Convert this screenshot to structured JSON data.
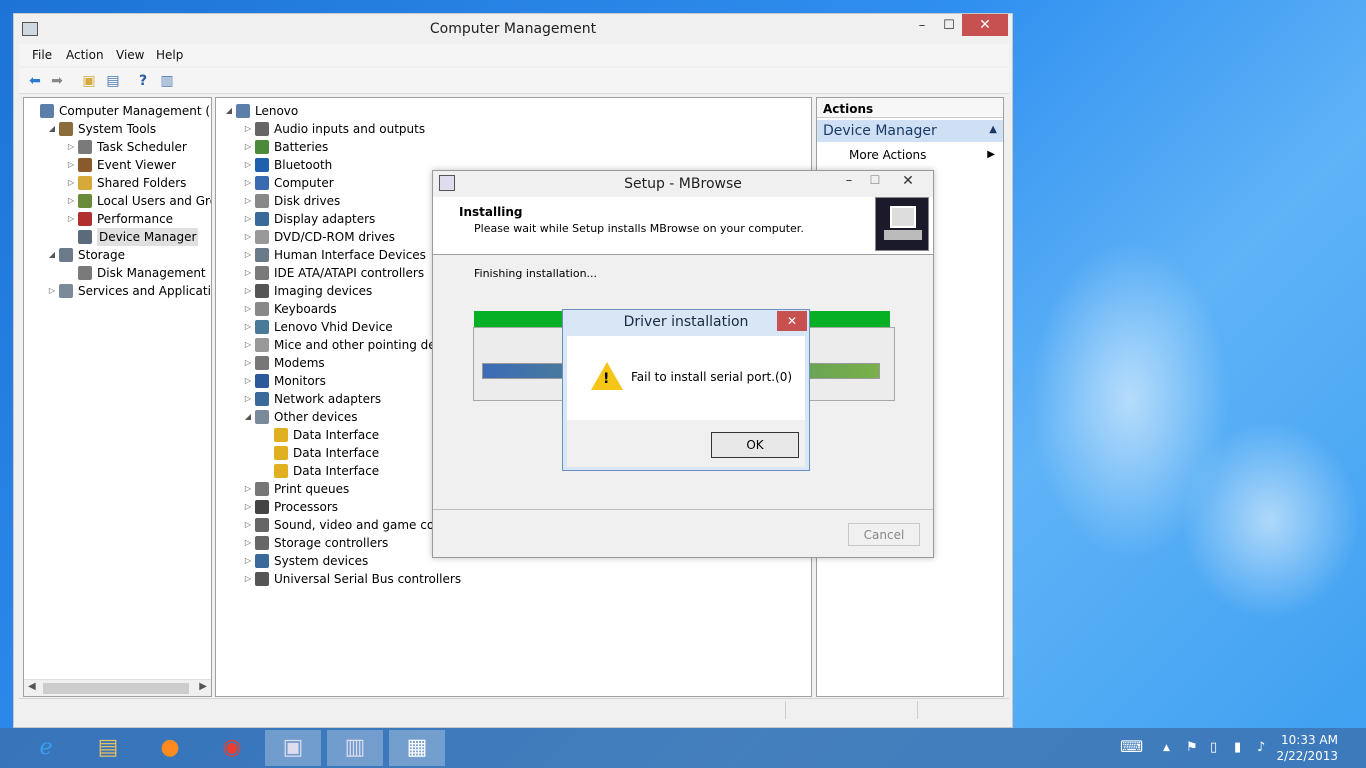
{
  "window": {
    "title": "Computer Management",
    "minimize": "–",
    "maximize": "☐",
    "close": "✕"
  },
  "menu": [
    "File",
    "Action",
    "View",
    "Help"
  ],
  "left_tree": [
    {
      "label": "Computer Management (Local",
      "level": 0,
      "exp": "",
      "icon": "computer-management-icon",
      "color": "#5b7fa8"
    },
    {
      "label": "System Tools",
      "level": 1,
      "exp": "◢",
      "icon": "system-tools-icon",
      "color": "#8a6d3b"
    },
    {
      "label": "Task Scheduler",
      "level": 2,
      "exp": "▷",
      "icon": "clock-icon",
      "color": "#7a7a7a"
    },
    {
      "label": "Event Viewer",
      "level": 2,
      "exp": "▷",
      "icon": "event-viewer-icon",
      "color": "#8a5a2a"
    },
    {
      "label": "Shared Folders",
      "level": 2,
      "exp": "▷",
      "icon": "shared-folder-icon",
      "color": "#d6a93a"
    },
    {
      "label": "Local Users and Groups",
      "level": 2,
      "exp": "▷",
      "icon": "users-icon",
      "color": "#6a8c3a"
    },
    {
      "label": "Performance",
      "level": 2,
      "exp": "▷",
      "icon": "performance-icon",
      "color": "#b03030"
    },
    {
      "label": "Device Manager",
      "level": 2,
      "exp": "",
      "icon": "device-manager-icon",
      "color": "#5b6b7b",
      "selected": true
    },
    {
      "label": "Storage",
      "level": 1,
      "exp": "◢",
      "icon": "storage-icon",
      "color": "#6b7b8b"
    },
    {
      "label": "Disk Management",
      "level": 2,
      "exp": "",
      "icon": "disk-icon",
      "color": "#7a7a7a"
    },
    {
      "label": "Services and Applications",
      "level": 1,
      "exp": "▷",
      "icon": "services-icon",
      "color": "#7a8a9a"
    }
  ],
  "device_tree": [
    {
      "label": "Lenovo",
      "level": 0,
      "exp": "◢",
      "icon": "computer-icon",
      "color": "#5b7fa8"
    },
    {
      "label": "Audio inputs and outputs",
      "level": 1,
      "exp": "▷",
      "icon": "speaker-icon",
      "color": "#666"
    },
    {
      "label": "Batteries",
      "level": 1,
      "exp": "▷",
      "icon": "battery-icon",
      "color": "#4a8a3a"
    },
    {
      "label": "Bluetooth",
      "level": 1,
      "exp": "▷",
      "icon": "bluetooth-icon",
      "color": "#1f5fb0"
    },
    {
      "label": "Computer",
      "level": 1,
      "exp": "▷",
      "icon": "computer-icon",
      "color": "#3a6ab0"
    },
    {
      "label": "Disk drives",
      "level": 1,
      "exp": "▷",
      "icon": "disk-icon",
      "color": "#888"
    },
    {
      "label": "Display adapters",
      "level": 1,
      "exp": "▷",
      "icon": "display-icon",
      "color": "#3a6a9a"
    },
    {
      "label": "DVD/CD-ROM drives",
      "level": 1,
      "exp": "▷",
      "icon": "dvd-icon",
      "color": "#999"
    },
    {
      "label": "Human Interface Devices",
      "level": 1,
      "exp": "▷",
      "icon": "hid-icon",
      "color": "#6a7a8a"
    },
    {
      "label": "IDE ATA/ATAPI controllers",
      "level": 1,
      "exp": "▷",
      "icon": "ide-icon",
      "color": "#7a7a7a"
    },
    {
      "label": "Imaging devices",
      "level": 1,
      "exp": "▷",
      "icon": "camera-icon",
      "color": "#555"
    },
    {
      "label": "Keyboards",
      "level": 1,
      "exp": "▷",
      "icon": "keyboard-icon",
      "color": "#888"
    },
    {
      "label": "Lenovo Vhid Device",
      "level": 1,
      "exp": "▷",
      "icon": "vhid-icon",
      "color": "#4a7a9a"
    },
    {
      "label": "Mice and other pointing devi",
      "level": 1,
      "exp": "▷",
      "icon": "mouse-icon",
      "color": "#999"
    },
    {
      "label": "Modems",
      "level": 1,
      "exp": "▷",
      "icon": "modem-icon",
      "color": "#777"
    },
    {
      "label": "Monitors",
      "level": 1,
      "exp": "▷",
      "icon": "monitor-icon",
      "color": "#2a5a9a"
    },
    {
      "label": "Network adapters",
      "level": 1,
      "exp": "▷",
      "icon": "network-icon",
      "color": "#3a6a9a"
    },
    {
      "label": "Other devices",
      "level": 1,
      "exp": "◢",
      "icon": "unknown-device-icon",
      "color": "#7a8a9a"
    },
    {
      "label": "Data Interface",
      "level": 2,
      "exp": "",
      "icon": "warning-device-icon",
      "color": "#e0b020"
    },
    {
      "label": "Data Interface",
      "level": 2,
      "exp": "",
      "icon": "warning-device-icon",
      "color": "#e0b020"
    },
    {
      "label": "Data Interface",
      "level": 2,
      "exp": "",
      "icon": "warning-device-icon",
      "color": "#e0b020"
    },
    {
      "label": "Print queues",
      "level": 1,
      "exp": "▷",
      "icon": "printer-icon",
      "color": "#777"
    },
    {
      "label": "Processors",
      "level": 1,
      "exp": "▷",
      "icon": "cpu-icon",
      "color": "#444"
    },
    {
      "label": "Sound, video and game cont",
      "level": 1,
      "exp": "▷",
      "icon": "speaker-icon",
      "color": "#666"
    },
    {
      "label": "Storage controllers",
      "level": 1,
      "exp": "▷",
      "icon": "storage-controller-icon",
      "color": "#666"
    },
    {
      "label": "System devices",
      "level": 1,
      "exp": "▷",
      "icon": "system-device-icon",
      "color": "#3a6a9a"
    },
    {
      "label": "Universal Serial Bus controllers",
      "level": 1,
      "exp": "▷",
      "icon": "usb-icon",
      "color": "#555"
    }
  ],
  "actions": {
    "header": "Actions",
    "section": "Device Manager",
    "item": "More Actions"
  },
  "setup": {
    "title": "Setup - MBrowse",
    "heading": "Installing",
    "subheading": "Please wait while Setup installs MBrowse on your computer.",
    "status": "Finishing installation...",
    "cancel": "Cancel"
  },
  "driver_dialog": {
    "title": "Driver installation",
    "message": "Fail to install serial port.(0)",
    "ok": "OK"
  },
  "taskbar": {
    "apps": [
      "internet-explorer-icon",
      "file-explorer-icon",
      "firefox-icon",
      "chrome-icon",
      "computer-management-icon",
      "setup-icon",
      "driver-install-icon"
    ],
    "time": "10:33 AM",
    "date": "2/22/2013"
  }
}
